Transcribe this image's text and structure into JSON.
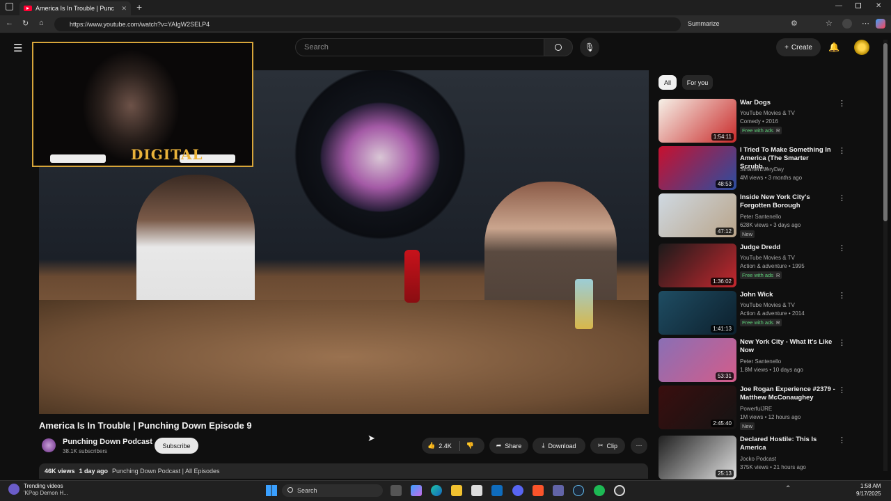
{
  "browser": {
    "tab_title": "America Is In Trouble | Punc",
    "url": "https://www.youtube.com/watch?v=YAIgW2SELP4",
    "summarize_label": "Summarize"
  },
  "header": {
    "search_placeholder": "Search",
    "create_label": "Create"
  },
  "pip": {
    "logo_text": "DIGITAL"
  },
  "video": {
    "title": "America Is In Trouble | Punching Down Episode 9",
    "channel": "Punching Down Podcast",
    "subscribers": "38.1K subscribers",
    "subscribe_label": "Subscribe",
    "likes": "2.4K",
    "share_label": "Share",
    "download_label": "Download",
    "clip_label": "Clip",
    "views": "46K views",
    "age": "1 day ago",
    "playlist": "Punching Down Podcast | All Episodes"
  },
  "chips": [
    {
      "label": "All"
    },
    {
      "label": "For you"
    }
  ],
  "recommendations": [
    {
      "title": "War Dogs",
      "channel": "YouTube Movies & TV",
      "meta": "Comedy • 2016",
      "duration": "1:54:11",
      "badges": [
        "Free with ads",
        "R"
      ],
      "colors": [
        "#f6f1e8",
        "#c92a2a"
      ]
    },
    {
      "title": "I Tried To Make Something In America (The Smarter Scrubb...",
      "channel": "SmarterEveryDay",
      "meta": "4M views • 3 months ago",
      "duration": "48:53",
      "badges": [],
      "colors": [
        "#c8102e",
        "#2a4ea1"
      ]
    },
    {
      "title": "Inside New York City's Forgotten Borough",
      "channel": "Peter Santenello",
      "meta": "628K views • 3 days ago",
      "duration": "47:12",
      "badges": [
        "New"
      ],
      "colors": [
        "#cfd9e2",
        "#b9a489"
      ]
    },
    {
      "title": "Judge Dredd",
      "channel": "YouTube Movies & TV",
      "meta": "Action & adventure • 1995",
      "duration": "1:36:02",
      "badges": [
        "Free with ads",
        "R"
      ],
      "colors": [
        "#1a1a1a",
        "#c5282f"
      ]
    },
    {
      "title": "John Wick",
      "channel": "YouTube Movies & TV",
      "meta": "Action & adventure • 2014",
      "duration": "1:41:13",
      "badges": [
        "Free with ads",
        "R"
      ],
      "colors": [
        "#1f4d63",
        "#0c1f2c"
      ]
    },
    {
      "title": "New York City - What It's Like Now",
      "channel": "Peter Santenello",
      "meta": "1.8M views • 10 days ago",
      "duration": "53:31",
      "badges": [],
      "colors": [
        "#8a6fb5",
        "#d35c8a"
      ]
    },
    {
      "title": "Joe Rogan Experience #2379 - Matthew McConaughey",
      "channel": "PowerfulJRE",
      "meta": "1M views • 12 hours ago",
      "duration": "2:45:40",
      "badges": [
        "New"
      ],
      "colors": [
        "#3a0e0e",
        "#141414"
      ]
    },
    {
      "title": "Declared Hostile: This Is America",
      "channel": "Jocko Podcast",
      "meta": "375K views • 21 hours ago",
      "duration": "25:13",
      "badges": [],
      "colors": [
        "#202020",
        "#e0e0e0"
      ]
    }
  ],
  "taskbar": {
    "weather_title": "Trending videos",
    "weather_sub": "'KPop Demon H...",
    "search_label": "Search",
    "time": "1:58 AM",
    "date": "9/17/2025"
  }
}
